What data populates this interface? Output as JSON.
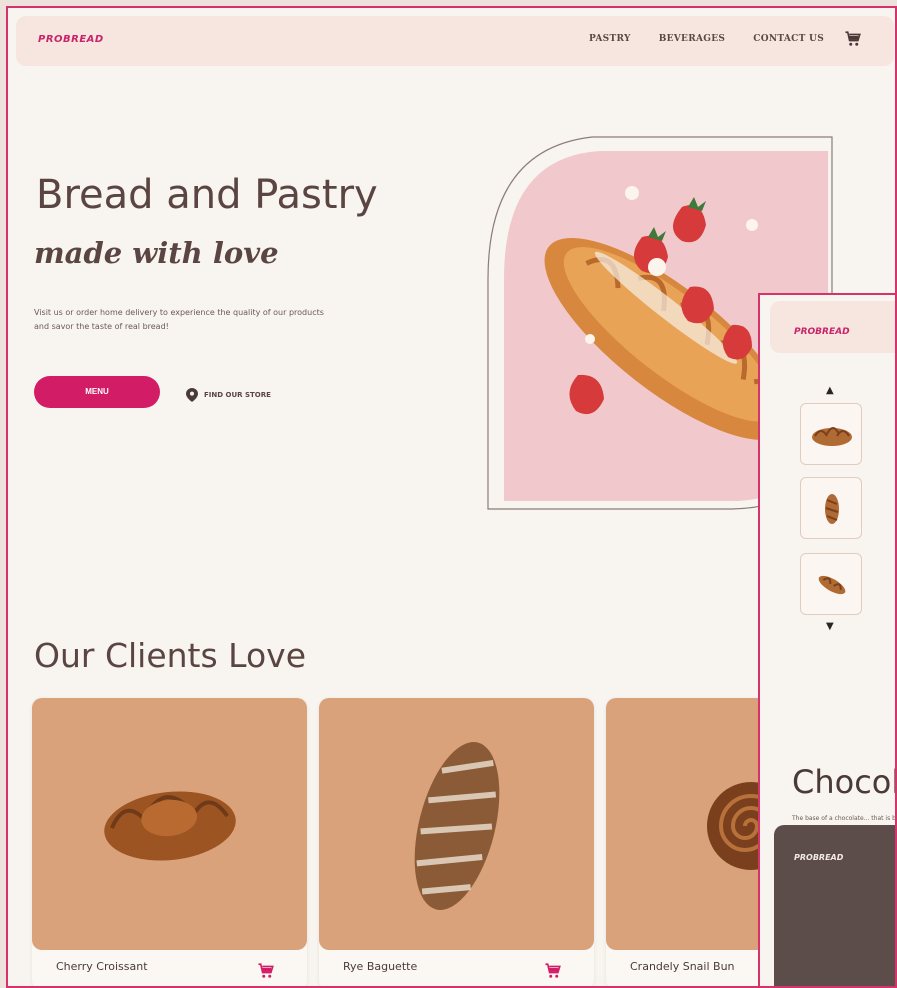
{
  "nav": {
    "logo": "PROBREAD",
    "links": [
      "PASTRY",
      "BEVERAGES",
      "CONTACT US"
    ],
    "cart_icon": "cart-icon"
  },
  "hero": {
    "title": "Bread and Pastry",
    "subtitle": "made with love",
    "text": "Visit us or order home delivery to experience the quality of our products and savor the taste of real bread!",
    "menu_button": "MENU",
    "store_link": "FIND OUR STORE",
    "image": "croissant-with-strawberries"
  },
  "clients": {
    "title": "Our Clients Love",
    "items": [
      {
        "name": "Cherry Croissant"
      },
      {
        "name": "Rye Baguette"
      },
      {
        "name": "Crandely Snail Bun"
      }
    ]
  },
  "overlay": {
    "logo": "PROBREAD",
    "heading": "Chocol",
    "description": "The base of a chocolate... that is baked to a golden... Inside the croissant, ther... and tangy note, as well a...",
    "footer_logo": "PROBREAD"
  },
  "colors": {
    "accent": "#d21d66",
    "background": "#f8f4ef",
    "nav_bg": "#f7e6df",
    "text": "#5a4542",
    "footer": "#5d4d4a"
  }
}
